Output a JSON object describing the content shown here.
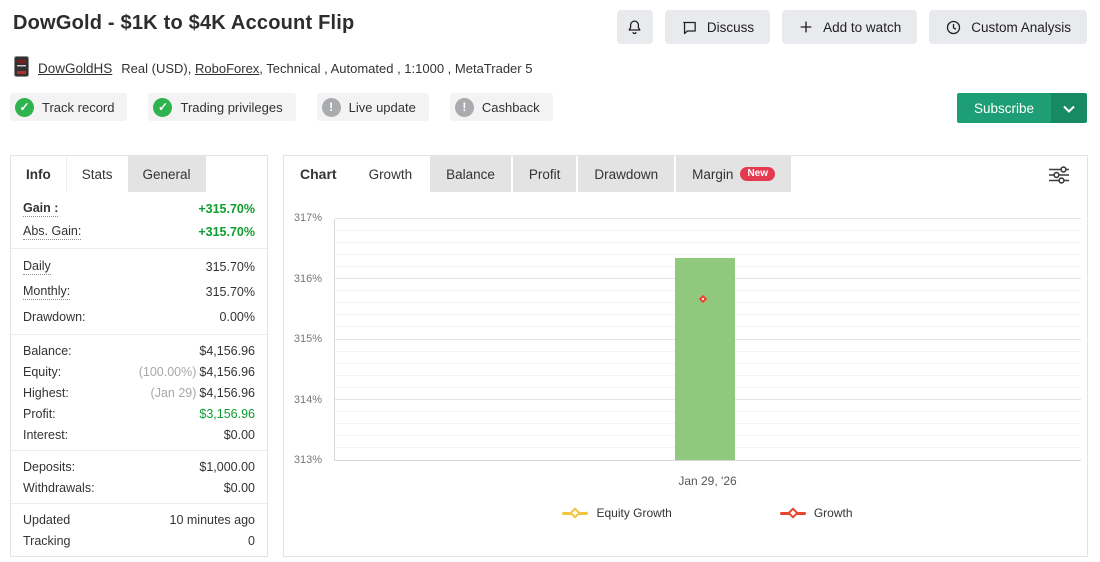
{
  "page": {
    "title": "DowGold - $1K to $4K Account Flip"
  },
  "header_actions": {
    "discuss": "Discuss",
    "add_to_watch": "Add to watch",
    "custom_analysis": "Custom Analysis"
  },
  "account": {
    "name": "DowGoldHS",
    "pre_broker": "Real (USD),",
    "broker": "RoboForex",
    "post_broker": ", Technical , Automated , 1:1000 , MetaTrader 5"
  },
  "badges": [
    {
      "label": "Track record",
      "status": "ok"
    },
    {
      "label": "Trading privileges",
      "status": "ok"
    },
    {
      "label": "Live update",
      "status": "warn"
    },
    {
      "label": "Cashback",
      "status": "warn"
    }
  ],
  "subscribe": {
    "label": "Subscribe"
  },
  "sidebar": {
    "tabs": [
      {
        "label": "Info"
      },
      {
        "label": "Stats",
        "active": true
      },
      {
        "label": "General"
      }
    ],
    "sections": [
      {
        "rows": [
          {
            "label": "Gain :",
            "value": "+315.70%"
          },
          {
            "label": "Abs. Gain:",
            "value": "+315.70%"
          }
        ]
      },
      {
        "rows": [
          {
            "label": "Daily",
            "value": "315.70%"
          },
          {
            "label": "Monthly:",
            "value": "315.70%"
          },
          {
            "label": "Drawdown:",
            "value": "0.00%"
          }
        ]
      },
      {
        "rows": [
          {
            "label": "Balance:",
            "value": "$4,156.96"
          },
          {
            "label": "Equity:",
            "prefix": "(100.00%)",
            "value": "$4,156.96"
          },
          {
            "label": "Highest:",
            "prefix": "(Jan 29)",
            "value": "$4,156.96"
          },
          {
            "label": "Profit:",
            "value": "$3,156.96"
          },
          {
            "label": "Interest:",
            "value": "$0.00"
          }
        ]
      },
      {
        "rows": [
          {
            "label": "Deposits:",
            "value": "$1,000.00"
          },
          {
            "label": "Withdrawals:",
            "value": "$0.00"
          }
        ]
      },
      {
        "rows": [
          {
            "label": "Updated",
            "value": "10 minutes ago"
          },
          {
            "label": "Tracking",
            "value": "0"
          }
        ]
      }
    ]
  },
  "chart_panel": {
    "title": "Chart",
    "tabs": [
      {
        "label": "Growth",
        "active": true
      },
      {
        "label": "Balance"
      },
      {
        "label": "Profit"
      },
      {
        "label": "Drawdown"
      },
      {
        "label": "Margin",
        "badge": "New"
      }
    ]
  },
  "chart_data": {
    "type": "bar",
    "categories": [
      "Jan 29, '26"
    ],
    "series": [
      {
        "name": "Equity Growth",
        "style": "line-marker",
        "color": "#f2c43d",
        "values": [
          315.7
        ]
      },
      {
        "name": "Growth",
        "style": "line-marker",
        "color": "#e8442c",
        "values": [
          315.7
        ]
      }
    ],
    "bar": {
      "color": "#90c97d",
      "top_value": 316.35,
      "category": "Jan 29, '26"
    },
    "title": "",
    "xlabel": "",
    "ylabel": "",
    "ylim": [
      313,
      317
    ],
    "ytick_step": 1,
    "grid_minor_step": 0.2,
    "yticks": [
      "313%",
      "314%",
      "315%",
      "316%",
      "317%"
    ],
    "grid": true,
    "legend_position": "bottom"
  },
  "colors": {
    "subscribe_green": "#1d9e74",
    "value_green": "#0c9e2f",
    "badge_ok_green": "#2eb34e",
    "badge_warn_gray": "#a9abae",
    "bar_green": "#90c97d",
    "growth_red": "#e8442c",
    "equity_yellow": "#f2c43d",
    "new_badge_red": "#e5394f"
  },
  "icons": {
    "bell": "bell-icon",
    "discuss": "speech-bubble-icon",
    "add": "plus-icon",
    "clock": "clock-icon",
    "caret": "chevron-down-icon",
    "filter": "sliders-icon",
    "ea_box": "ea-product-box-icon"
  }
}
